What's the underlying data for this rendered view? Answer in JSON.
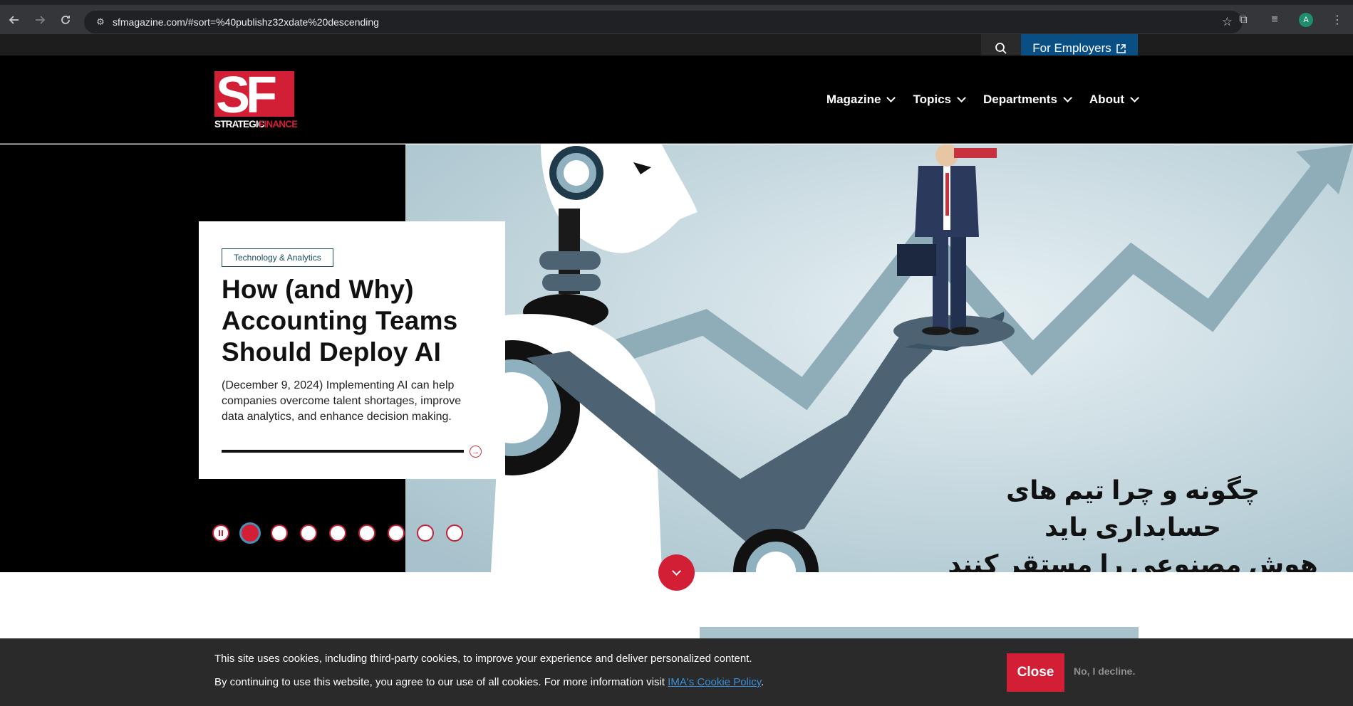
{
  "browser": {
    "url": "sfmagazine.com/#sort=%40publishz32xdate%20descending",
    "profile_initial": "A"
  },
  "utility": {
    "employers_label": "For Employers"
  },
  "logo": {
    "letters": "SF",
    "word_strategic": "STRATEGIC",
    "word_finance": "FINANCE"
  },
  "nav": {
    "items": [
      "Magazine",
      "Topics",
      "Departments",
      "About"
    ]
  },
  "hero": {
    "tag": "Technology & Analytics",
    "title": "How (and Why) Accounting Teams Should Deploy AI",
    "summary": "(December 9, 2024) Implementing AI can help companies overcome talent shortages, improve data analytics, and enhance decision making.",
    "image_caption_line1": "چگونه و چرا تیم های حسابداری باید",
    "image_caption_line2": "هوش مصنوعی را مستقر کنند",
    "slide_count": 8,
    "active_slide": 1
  },
  "cookie": {
    "line1": "This site uses cookies, including third-party cookies, to improve your experience and deliver personalized content.",
    "line2_prefix": "By continuing to use this website, you agree to our use of all cookies. For more information visit ",
    "policy_link": "IMA's Cookie Policy",
    "line2_suffix": ".",
    "close_label": "Close",
    "decline_label": "No, I decline."
  },
  "colors": {
    "brand_red": "#d21f36",
    "employers_blue": "#0a4f83",
    "hero_bg": "#cfe0e6"
  }
}
